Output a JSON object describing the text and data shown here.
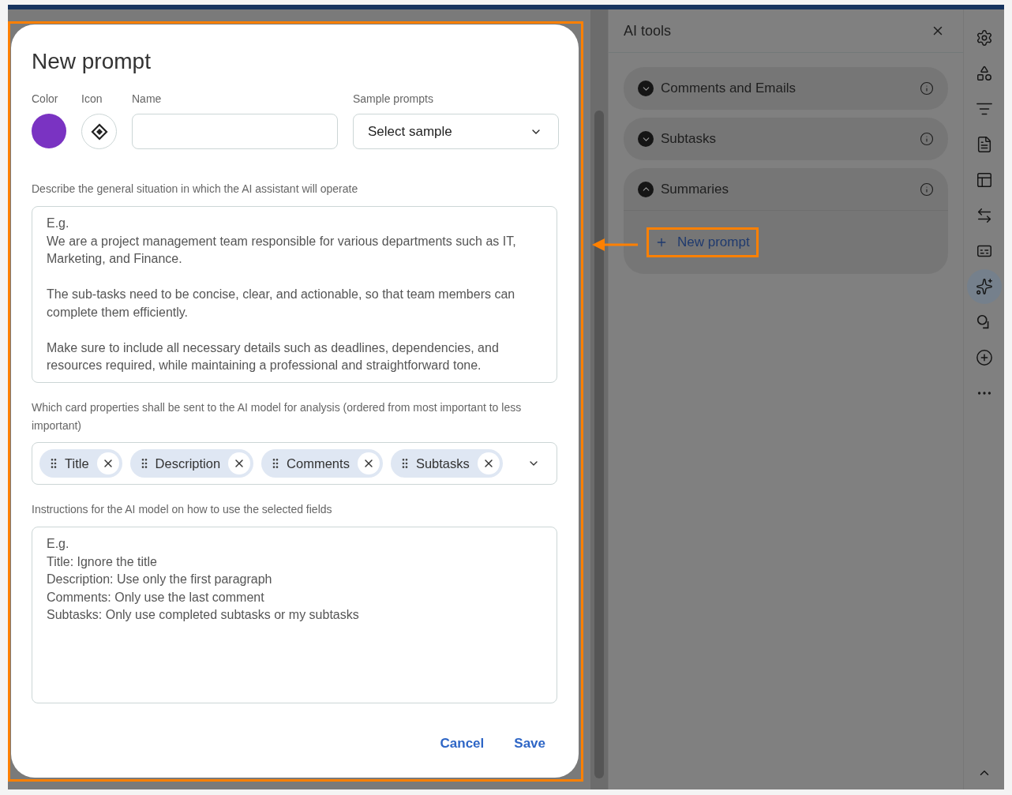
{
  "dialog": {
    "title": "New prompt",
    "color_picker": {
      "label": "Color",
      "color": "#7a33c2"
    },
    "icon_picker": {
      "label": "Icon"
    },
    "name_field": {
      "label": "Name"
    },
    "sample_select": {
      "label": "Sample prompts",
      "value": "Select sample"
    },
    "situation": {
      "label": "Describe the general situation in which the AI assistant will operate",
      "placeholder": "E.g.\nWe are a project management team responsible for various departments such as IT, Marketing, and Finance.\n\nThe sub-tasks need to be concise, clear, and actionable, so that team members can complete them efficiently.\n\nMake sure to include all necessary details such as deadlines, dependencies, and resources required, while maintaining a professional and straightforward tone."
    },
    "properties": {
      "label": "Which card properties shall be sent to the AI model for analysis (ordered from most important to less important)",
      "chips": [
        {
          "label": "Title"
        },
        {
          "label": "Description"
        },
        {
          "label": "Comments"
        },
        {
          "label": "Subtasks"
        }
      ]
    },
    "instructions": {
      "label": "Instructions for the AI model on how to use the selected fields",
      "placeholder": "E.g.\nTitle: Ignore the title\nDescription: Use only the first paragraph\nComments: Only use the last comment\nSubtasks: Only use completed subtasks or my subtasks"
    },
    "buttons": [
      "Cancel",
      "Save"
    ]
  },
  "panel": {
    "title": "AI tools",
    "sections": [
      {
        "title": "Comments and Emails",
        "expanded": false
      },
      {
        "title": "Subtasks",
        "expanded": false
      },
      {
        "title": "Summaries",
        "expanded": true,
        "action": "New prompt"
      }
    ]
  },
  "tool_rail": [
    {
      "kind": "settings",
      "selected": false
    },
    {
      "kind": "shapes",
      "selected": false
    },
    {
      "kind": "filter",
      "selected": false
    },
    {
      "kind": "document",
      "selected": false
    },
    {
      "kind": "layout",
      "selected": false
    },
    {
      "kind": "swap",
      "selected": false
    },
    {
      "kind": "caption",
      "selected": false
    },
    {
      "kind": "sparkles",
      "selected": true
    },
    {
      "kind": "search",
      "selected": false
    },
    {
      "kind": "add",
      "selected": false
    },
    {
      "kind": "more",
      "selected": false
    }
  ]
}
